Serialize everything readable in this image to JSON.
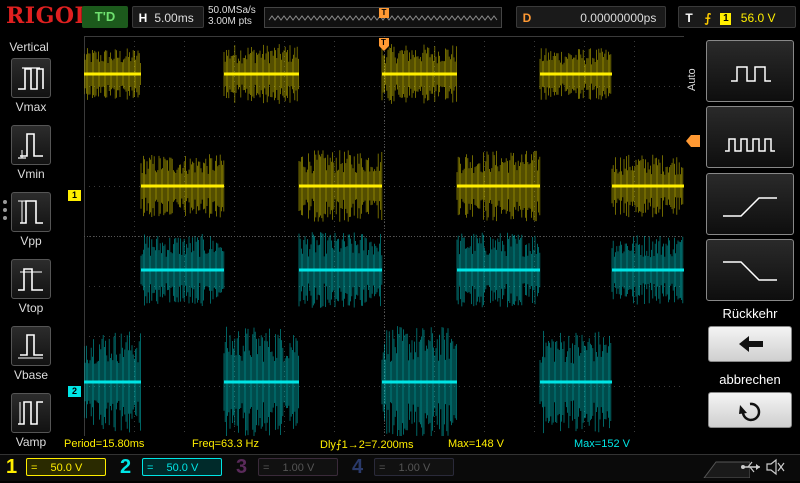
{
  "brand": "RIGOL",
  "header": {
    "run_status": "T'D",
    "horizontal": {
      "tag": "H",
      "timebase": "5.00ms"
    },
    "sample_rate": "50.0MSa/s",
    "memory_depth": "3.00M pts",
    "trigger_marker": "T",
    "delay": {
      "tag": "D",
      "value": "0.00000000ps"
    },
    "trigger": {
      "tag": "T",
      "edge_symbol": "⨍",
      "source": "1",
      "level": "56.0 V"
    }
  },
  "sidebar": {
    "title": "Vertical",
    "items": [
      {
        "label": "Vmax",
        "icon": "vmax-icon"
      },
      {
        "label": "Vmin",
        "icon": "vmin-icon"
      },
      {
        "label": "Vpp",
        "icon": "vpp-icon"
      },
      {
        "label": "Vtop",
        "icon": "vtop-icon"
      },
      {
        "label": "Vbase",
        "icon": "vbase-icon"
      },
      {
        "label": "Vamp",
        "icon": "vamp-icon"
      }
    ]
  },
  "right_panel": {
    "mode": "Auto",
    "buttons": [
      {
        "icon": "single-period-icon"
      },
      {
        "icon": "multi-period-icon"
      },
      {
        "icon": "rising-edge-icon"
      },
      {
        "icon": "falling-edge-icon"
      }
    ],
    "back_label": "Rückkehr",
    "back_icon": "arrow-left-icon",
    "cancel_label": "abbrechen",
    "cancel_icon": "undo-icon"
  },
  "channel_markers": {
    "ch1": "1",
    "ch2": "2"
  },
  "measurements": [
    {
      "text": "Period=15.80ms"
    },
    {
      "text": "Freq=63.3 Hz"
    },
    {
      "text": "Dly⨍1→2=7.200ms"
    },
    {
      "text": "Max=148 V"
    },
    {
      "text": "Max=152 V"
    }
  ],
  "channels": [
    {
      "num": "1",
      "coupling": "=",
      "scale": "50.0 V",
      "color": "#ffee00",
      "active": true
    },
    {
      "num": "2",
      "coupling": "=",
      "scale": "50.0 V",
      "color": "#00e5e5",
      "active": true
    },
    {
      "num": "3",
      "coupling": "=",
      "scale": "1.00 V",
      "color": "#cc44cc",
      "active": false
    },
    {
      "num": "4",
      "coupling": "=",
      "scale": "1.00 V",
      "color": "#4477ff",
      "active": false
    }
  ],
  "colors": {
    "ch1": "#ffee00",
    "ch2": "#00e5e5",
    "trigger": "#ff9933",
    "brand": "#e02020"
  }
}
